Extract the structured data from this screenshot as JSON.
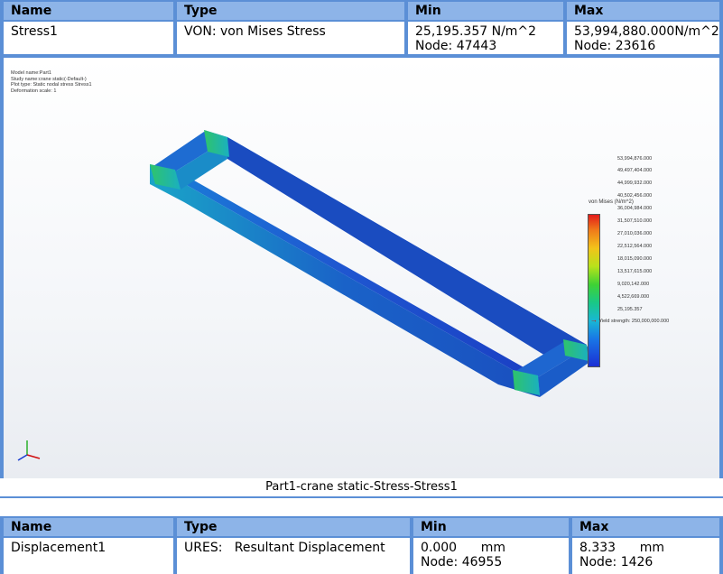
{
  "stress_table": {
    "headers": [
      "Name",
      "Type",
      "Min",
      "Max"
    ],
    "name": "Stress1",
    "type": "VON: von Mises Stress",
    "min_value": "25,195.357 N/m^2",
    "min_node": "Node: 47443",
    "max_value": "53,994,880.000N/m^2",
    "max_node": "Node: 23616"
  },
  "figure": {
    "meta_lines": [
      "Model name:Part1",
      "Study name:crane static(-Default-)",
      "Plot type: Static nodal stress Stress1",
      "Deformation scale: 1"
    ],
    "legend_title": "von Mises (N/m^2)",
    "legend_labels": [
      "53,994,876.000",
      "49,497,404.000",
      "44,999,932.000",
      "40,502,456.000",
      "36,004,984.000",
      "31,507,510.000",
      "27,010,036.000",
      "22,512,564.000",
      "18,015,090.000",
      "13,517,615.000",
      "9,020,142.000",
      "4,522,669.000",
      "25,195.357"
    ],
    "yield_label": "Yield strength: 250,000,000.000",
    "caption": "Part1-crane static-Stress-Stress1",
    "colors": {
      "max": "#e31b1b",
      "min": "#1b2fd4",
      "yield_arrow": "#d01010"
    }
  },
  "displacement_table": {
    "headers": [
      "Name",
      "Type",
      "Min",
      "Max"
    ],
    "name": "Displacement1",
    "type": "URES:   Resultant Displacement",
    "min_value": "0.000      mm",
    "min_node": "Node: 46955",
    "max_value": "8.333      mm",
    "max_node": "Node: 1426"
  }
}
